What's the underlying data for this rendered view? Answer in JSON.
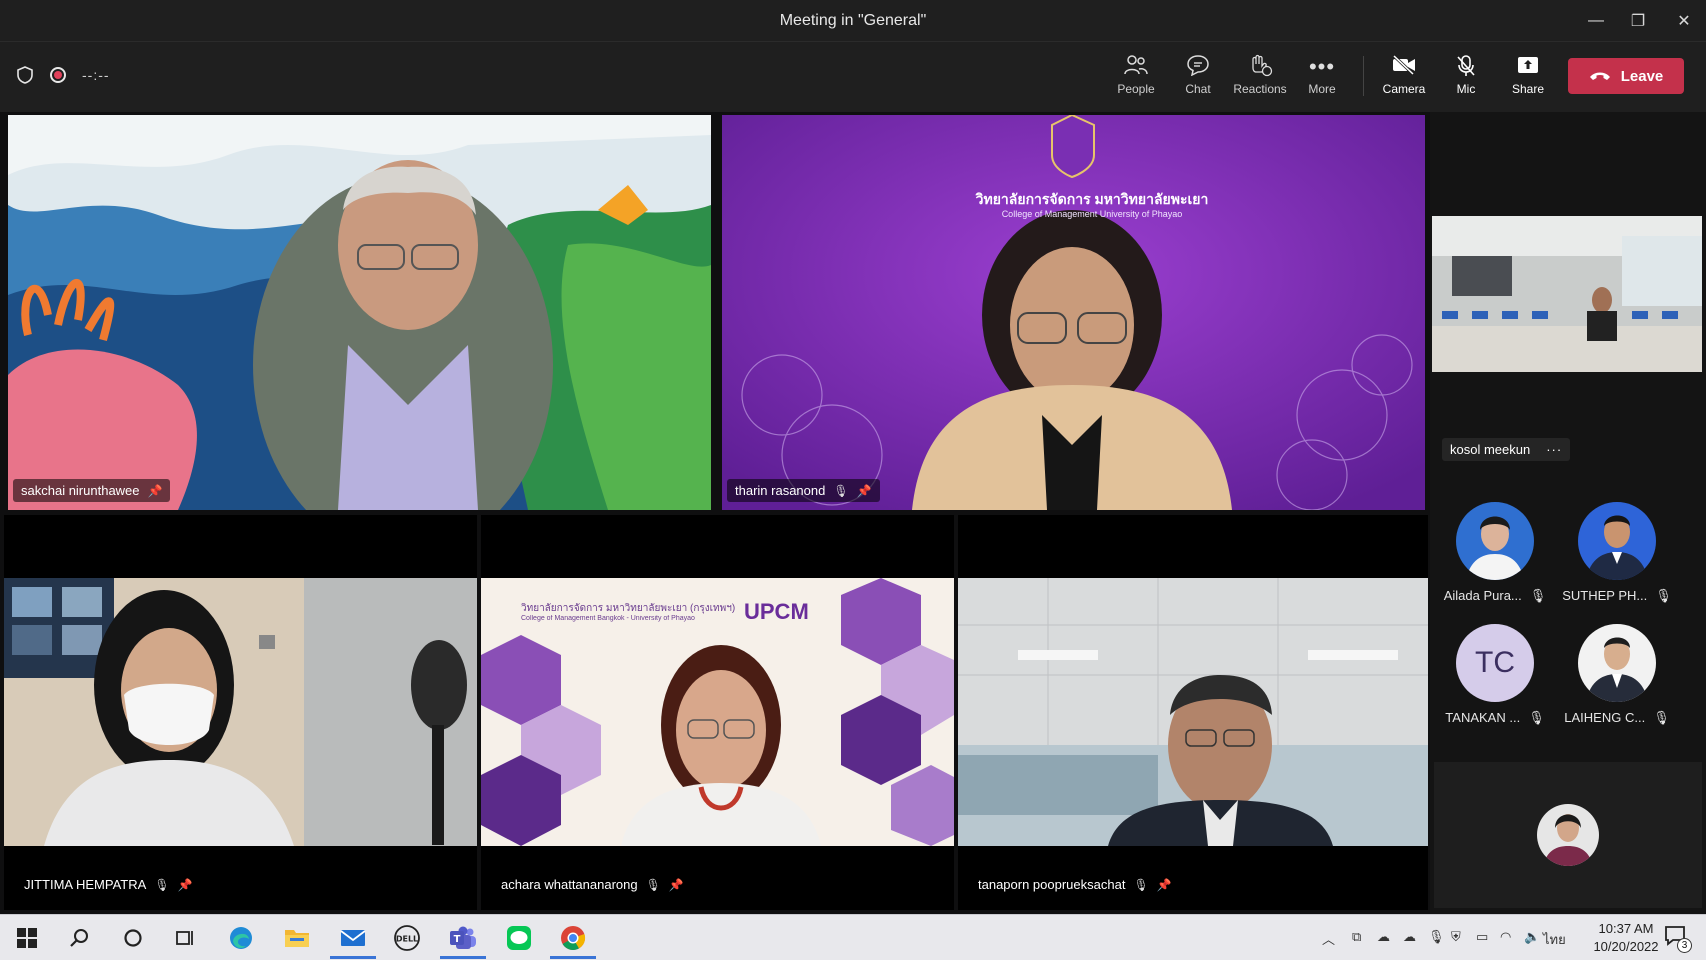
{
  "window": {
    "title": "Meeting in \"General\""
  },
  "toolbar": {
    "timer": "--:--",
    "people": "People",
    "chat": "Chat",
    "reactions": "Reactions",
    "more": "More",
    "camera": "Camera",
    "mic": "Mic",
    "share": "Share",
    "leave": "Leave"
  },
  "participants": {
    "sakchai": "sakchai nirunthawee",
    "tharin": "tharin rasanond",
    "jittima": "JITTIMA HEMPATRA",
    "achara": "achara whattananarong",
    "tanaporn": "tanaporn pooprueksachat",
    "kosol": "kosol meekun"
  },
  "banners": {
    "tharin_logo": "วิทยาลัยการจัดการ มหาวิทยาลัยพะเยา",
    "tharin_sub": "College of Management University of Phayao",
    "achara_title": "วิทยาลัยการจัดการ มหาวิทยาลัยพะเยา (กรุงเทพฯ)",
    "achara_sub": "College of Management Bangkok - University of Phayao",
    "achara_brand": "UPCM"
  },
  "roster": [
    {
      "name": "Ailada Pura..."
    },
    {
      "name": "SUTHEP PH..."
    },
    {
      "name": "TANAKAN ...",
      "initials": "TC"
    },
    {
      "name": "LAIHENG C..."
    }
  ],
  "taskbar": {
    "time": "10:37 AM",
    "date": "10/20/2022",
    "lang": "ไทย",
    "notifications": "3"
  },
  "colors": {
    "leave": "#c4314b",
    "titlebar": "#1f1f1f",
    "tc_avatar": "#d5ccea"
  }
}
